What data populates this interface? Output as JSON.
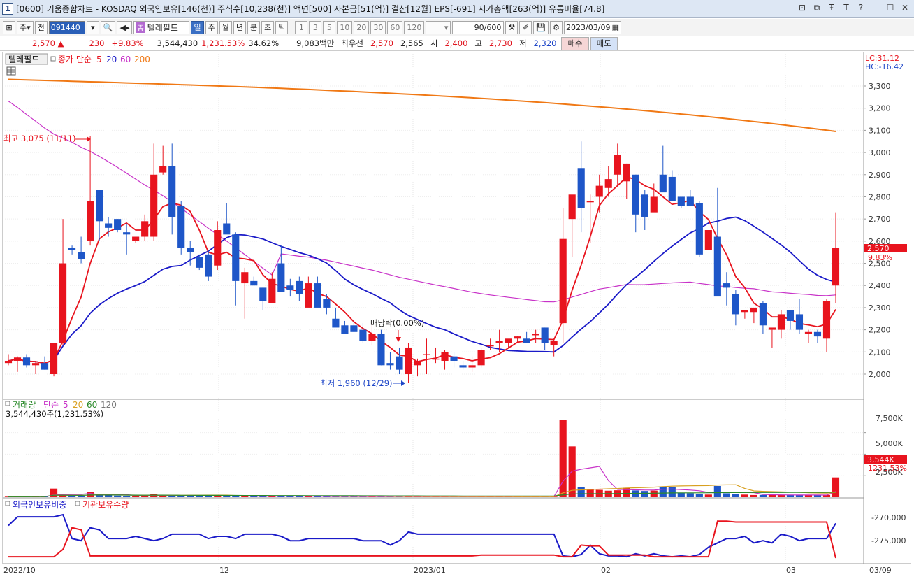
{
  "window": {
    "number": "1",
    "title": "[0600] 키움종합차트 - KOSDAQ 외국인보유[146(천)] 주식수[10,238(천)] 액면[500] 자본금[51(억)] 결산[12월] EPS[-691] 시가총액[263(억)] 유통비율[74.8]",
    "buttons": [
      "⊡",
      "⧉",
      "Ŧ",
      "T",
      "?",
      "—",
      "☐",
      "✕"
    ]
  },
  "toolbar": {
    "type_select": "주",
    "prev_label": "전",
    "code": "091440",
    "stock_name": "텔레필드",
    "name_tag": "종",
    "periods": [
      "일",
      "주",
      "월",
      "년",
      "분",
      "초",
      "틱"
    ],
    "active_period": "일",
    "intervals": [
      "1",
      "3",
      "5",
      "10",
      "20",
      "30",
      "60",
      "120"
    ],
    "count": "90/600",
    "date": "2023/03/09"
  },
  "quote": {
    "price": "2,570",
    "arrow": "▲",
    "change": "230",
    "change_pct": "+9.83%",
    "volume": "3,544,430",
    "volume_pct": "1,231.53%",
    "turnover_pct": "34.62%",
    "amount": "9,083백만",
    "bid_label": "최우선",
    "bid1": "2,570",
    "bid2": "2,565",
    "open_label": "시",
    "open": "2,400",
    "high_label": "고",
    "high": "2,730",
    "low_label": "저",
    "low": "2,320",
    "buy_label": "매수",
    "sell_label": "매도"
  },
  "price_panel": {
    "legend_name": "텔레필드",
    "legend_series": "종가 단순",
    "ma_periods": [
      "5",
      "20",
      "60",
      "200"
    ],
    "lc_label": "LC:31.12",
    "hc_label": "HC:-16.42",
    "high_annotation": "최고 3,075 (11/11)",
    "low_annotation": "최저 1,960 (12/29)",
    "dividend_annotation": "배당락(0.00%)",
    "current_price_tag": "2,570",
    "current_pct_tag": "9.83%",
    "y_ticks": [
      "3,300",
      "3,200",
      "3,100",
      "3,000",
      "2,900",
      "2,800",
      "2,700",
      "2,600",
      "2,500",
      "2,400",
      "2,300",
      "2,200",
      "2,100",
      "2,000"
    ]
  },
  "volume_panel": {
    "legend_name": "거래량",
    "legend_series": "단순",
    "ma_periods": [
      "5",
      "20",
      "60",
      "120"
    ],
    "current_label": "3,544,430주(1,231.53%)",
    "tag_value": "3,544K",
    "tag_pct": "1231.53%",
    "y_ticks": [
      "7,500K",
      "5,000K",
      "2,500K"
    ]
  },
  "foreign_panel": {
    "legend_a": "외국인보유비중",
    "legend_b": "기관보유수량",
    "y_ticks": [
      "-270,000",
      "-275,000"
    ]
  },
  "x_axis": {
    "labels": [
      "2022/10",
      "12",
      "2023/01",
      "02",
      "03"
    ],
    "end_label": "03/09"
  },
  "colors": {
    "up": "#e8141e",
    "down": "#1e56c8",
    "ma5": "#e8141e",
    "ma20": "#1a1ac8",
    "ma60": "#c832c8",
    "ma200": "#f07814",
    "foreign_line": "#1a1ac8",
    "inst_line": "#e8141e"
  },
  "chart_data": {
    "type": "candlestick",
    "candles_ohlc": [
      [
        2050,
        2090,
        2040,
        2060
      ],
      [
        2060,
        2080,
        2010,
        2075
      ],
      [
        2075,
        2090,
        2030,
        2040
      ],
      [
        2040,
        2060,
        2000,
        2050
      ],
      [
        2050,
        2080,
        2020,
        2020
      ],
      [
        2000,
        2140,
        1990,
        2140
      ],
      [
        2140,
        2700,
        2130,
        2500
      ],
      [
        2570,
        2580,
        2540,
        2560
      ],
      [
        2550,
        2620,
        2500,
        2520
      ],
      [
        2600,
        3075,
        2580,
        2780
      ],
      [
        2830,
        2830,
        2600,
        2690
      ],
      [
        2680,
        2710,
        2620,
        2660
      ],
      [
        2700,
        2700,
        2640,
        2650
      ],
      [
        2640,
        2680,
        2540,
        2630
      ],
      [
        2600,
        2620,
        2590,
        2620
      ],
      [
        2620,
        2720,
        2600,
        2690
      ],
      [
        2620,
        3040,
        2600,
        2900
      ],
      [
        2910,
        3030,
        2900,
        2940
      ],
      [
        2940,
        3040,
        2630,
        2710
      ],
      [
        2760,
        2780,
        2540,
        2570
      ],
      [
        2570,
        2600,
        2490,
        2550
      ],
      [
        2530,
        2540,
        2470,
        2480
      ],
      [
        2540,
        2560,
        2420,
        2440
      ],
      [
        2490,
        2690,
        2470,
        2650
      ],
      [
        2680,
        2770,
        2640,
        2630
      ],
      [
        2630,
        2640,
        2310,
        2420
      ],
      [
        2410,
        2480,
        2250,
        2460
      ],
      [
        2420,
        2440,
        2400,
        2400
      ],
      [
        2390,
        2390,
        2290,
        2330
      ],
      [
        2320,
        2460,
        2320,
        2430
      ],
      [
        2500,
        2580,
        2370,
        2370
      ],
      [
        2400,
        2430,
        2350,
        2380
      ],
      [
        2420,
        2440,
        2330,
        2360
      ],
      [
        2300,
        2440,
        2340,
        2410
      ],
      [
        2410,
        2440,
        2340,
        2300
      ],
      [
        2340,
        2360,
        2270,
        2300
      ],
      [
        2250,
        2300,
        2240,
        2210
      ],
      [
        2220,
        2240,
        2180,
        2180
      ],
      [
        2220,
        2240,
        2190,
        2190
      ],
      [
        2200,
        2230,
        2140,
        2150
      ],
      [
        2150,
        2230,
        2130,
        2180
      ],
      [
        2180,
        2200,
        2040,
        2040
      ],
      [
        2050,
        2100,
        2020,
        2040
      ],
      [
        2080,
        2120,
        2000,
        2020
      ],
      [
        2000,
        2140,
        1960,
        2120
      ],
      [
        2040,
        2070,
        1990,
        2060
      ],
      [
        2090,
        2160,
        2000,
        2090
      ],
      [
        2070,
        2120,
        2050,
        2070
      ],
      [
        2060,
        2110,
        2020,
        2100
      ],
      [
        2080,
        2100,
        2030,
        2060
      ],
      [
        2040,
        2060,
        2020,
        2030
      ],
      [
        2030,
        2080,
        2010,
        2040
      ],
      [
        2040,
        2120,
        2030,
        2110
      ],
      [
        2130,
        2160,
        2110,
        2130
      ],
      [
        2140,
        2200,
        2100,
        2150
      ],
      [
        2140,
        2150,
        2120,
        2160
      ],
      [
        2160,
        2170,
        2140,
        2170
      ],
      [
        2160,
        2190,
        2140,
        2140
      ],
      [
        2180,
        2200,
        2140,
        2180
      ],
      [
        2210,
        2210,
        2110,
        2140
      ],
      [
        2130,
        2160,
        2080,
        2150
      ],
      [
        2230,
        2750,
        2140,
        2610
      ],
      [
        2700,
        2800,
        2530,
        2810
      ],
      [
        2930,
        3050,
        2640,
        2750
      ],
      [
        2780,
        2810,
        2590,
        2780
      ],
      [
        2800,
        2900,
        2730,
        2850
      ],
      [
        2840,
        2940,
        2800,
        2880
      ],
      [
        2900,
        3040,
        2850,
        2990
      ],
      [
        2870,
        2950,
        2790,
        2950
      ],
      [
        2900,
        2900,
        2640,
        2720
      ],
      [
        2810,
        2830,
        2650,
        2710
      ],
      [
        2730,
        2860,
        2740,
        2800
      ],
      [
        2900,
        3030,
        2860,
        2820
      ],
      [
        2890,
        2920,
        2810,
        2780
      ],
      [
        2800,
        2800,
        2750,
        2760
      ],
      [
        2800,
        2830,
        2770,
        2760
      ],
      [
        2770,
        2780,
        2530,
        2540
      ],
      [
        2560,
        2640,
        2560,
        2650
      ],
      [
        2620,
        2840,
        2360,
        2350
      ],
      [
        2410,
        2460,
        2310,
        2390
      ],
      [
        2360,
        2380,
        2220,
        2270
      ],
      [
        2280,
        2290,
        2250,
        2290
      ],
      [
        2280,
        2290,
        2230,
        2300
      ],
      [
        2320,
        2330,
        2180,
        2220
      ],
      [
        2200,
        2200,
        2120,
        2210
      ],
      [
        2200,
        2290,
        2160,
        2270
      ],
      [
        2290,
        2290,
        2200,
        2240
      ],
      [
        2270,
        2340,
        2180,
        2200
      ],
      [
        2180,
        2200,
        2140,
        2190
      ],
      [
        2190,
        2200,
        2140,
        2170
      ],
      [
        2160,
        2340,
        2100,
        2330
      ],
      [
        2400,
        2730,
        2320,
        2570
      ]
    ],
    "volume_values_k": [
      60,
      50,
      60,
      80,
      90,
      1000,
      230,
      200,
      150,
      620,
      280,
      240,
      180,
      160,
      130,
      150,
      340,
      150,
      150,
      130,
      120,
      130,
      110,
      200,
      120,
      110,
      100,
      90,
      130,
      110,
      190,
      90,
      80,
      80,
      100,
      90,
      70,
      70,
      80,
      70,
      90,
      60,
      60,
      60,
      60,
      50,
      60,
      50,
      60,
      50,
      50,
      50,
      60,
      60,
      50,
      60,
      60,
      60,
      70,
      70,
      60,
      9000,
      5900,
      1200,
      900,
      850,
      750,
      800,
      1100,
      780,
      720,
      760,
      1250,
      1180,
      500,
      450,
      350,
      300,
      1300,
      450,
      350,
      300,
      250,
      260,
      250,
      280,
      240,
      230,
      240,
      250,
      260,
      2300,
      3544
    ]
  }
}
